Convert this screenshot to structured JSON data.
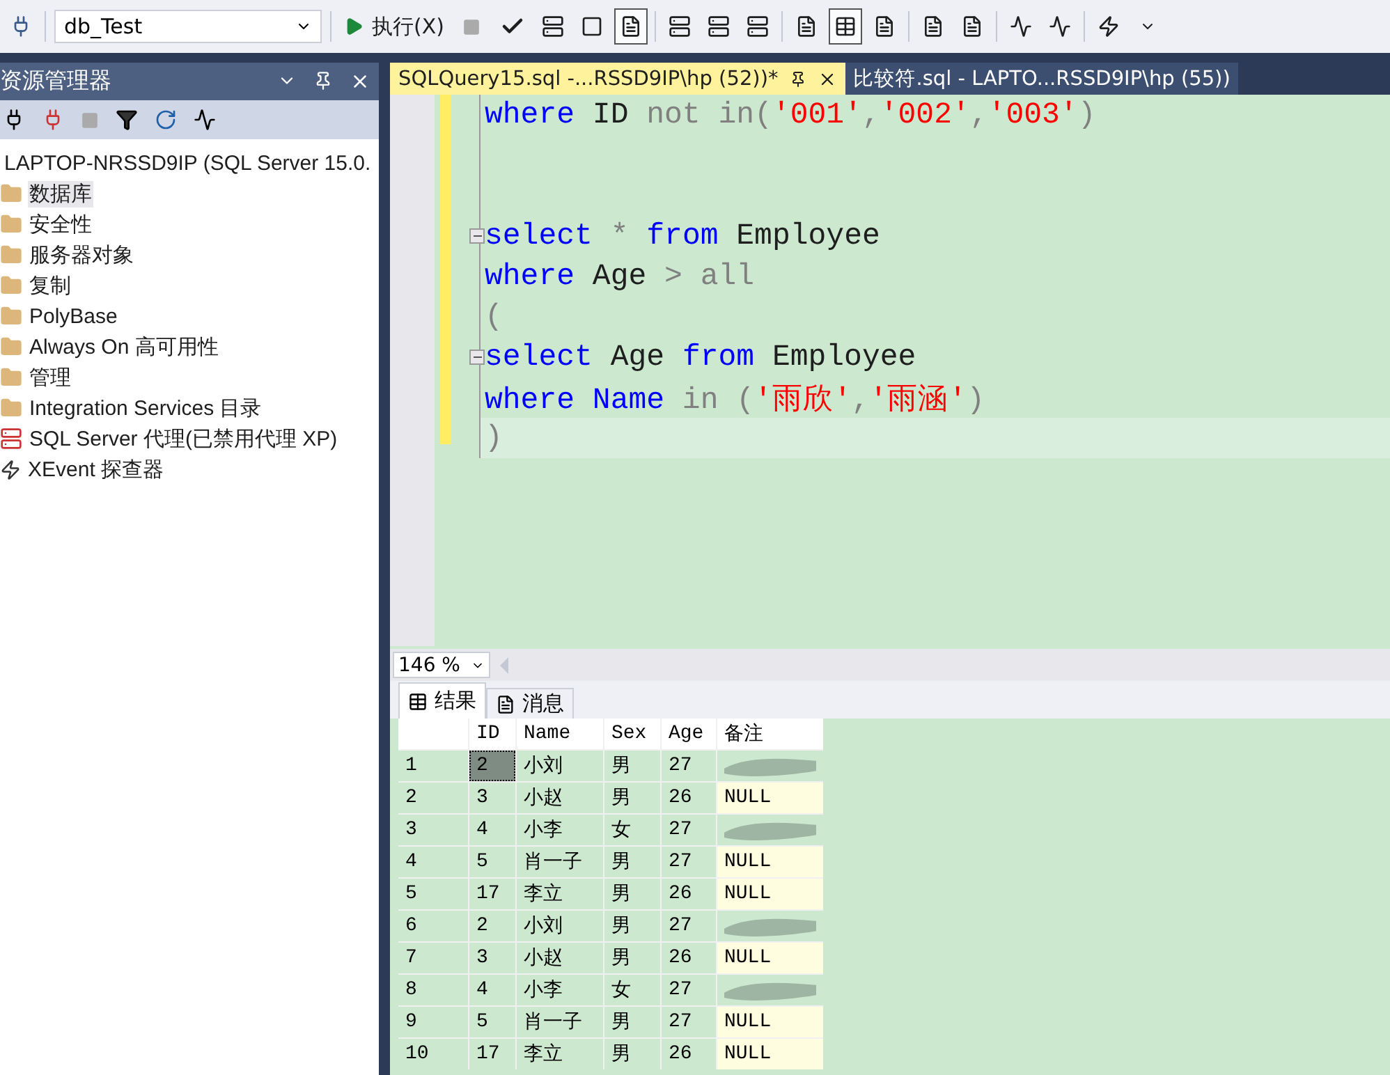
{
  "toolbar": {
    "database": "db_Test",
    "execute": "执行(X)"
  },
  "object_explorer": {
    "title": "资源管理器",
    "tree": [
      {
        "label": "LAPTOP-NRSSD9IP (SQL Server 15.0.",
        "selected": false,
        "children": [
          {
            "label": "数据库",
            "kind": "folder",
            "selected": true
          },
          {
            "label": "安全性",
            "kind": "folder",
            "selected": false
          },
          {
            "label": "服务器对象",
            "kind": "folder",
            "selected": false
          },
          {
            "label": "复制",
            "kind": "folder",
            "selected": false
          },
          {
            "label": "PolyBase",
            "kind": "folder",
            "selected": false
          },
          {
            "label": "Always On 高可用性",
            "kind": "folder",
            "selected": false
          },
          {
            "label": "管理",
            "kind": "folder",
            "selected": false
          },
          {
            "label": "Integration Services 目录",
            "kind": "folder",
            "selected": false
          },
          {
            "label": "SQL Server 代理(已禁用代理 XP)",
            "kind": "agent",
            "selected": false
          },
          {
            "label": "XEvent 探查器",
            "kind": "xevent",
            "selected": false
          }
        ]
      }
    ]
  },
  "tabs": [
    {
      "label": "SQLQuery15.sql -...RSSD9IP\\hp (52))*",
      "selected": true
    },
    {
      "label": "比较符.sql - LAPTO...RSSD9IP\\hp (55))",
      "selected": false
    }
  ],
  "editor": {
    "lines": [
      {
        "fold": false,
        "current": false,
        "tokens": [
          {
            "kind": "keyword",
            "text": "where"
          },
          {
            "kind": "ident",
            "text": " ID "
          },
          {
            "kind": "operator",
            "text": "not in("
          },
          {
            "kind": "string",
            "text": "'001'"
          },
          {
            "kind": "operator",
            "text": ","
          },
          {
            "kind": "string",
            "text": "'002'"
          },
          {
            "kind": "operator",
            "text": ","
          },
          {
            "kind": "string",
            "text": "'003'"
          },
          {
            "kind": "operator",
            "text": ")"
          }
        ]
      },
      {
        "fold": false,
        "current": false
      },
      {
        "fold": false,
        "current": false
      },
      {
        "fold": true,
        "current": false,
        "tokens": [
          {
            "kind": "keyword",
            "text": "select"
          },
          {
            "kind": "operator",
            "text": " * "
          },
          {
            "kind": "keyword",
            "text": "from"
          },
          {
            "kind": "ident",
            "text": " Employee"
          }
        ]
      },
      {
        "fold": false,
        "current": false,
        "tokens": [
          {
            "kind": "keyword",
            "text": "where"
          },
          {
            "kind": "ident",
            "text": " Age "
          },
          {
            "kind": "operator",
            "text": "> all"
          }
        ]
      },
      {
        "fold": false,
        "current": false,
        "tokens": [
          {
            "kind": "operator",
            "text": "("
          }
        ]
      },
      {
        "fold": true,
        "current": false,
        "tokens": [
          {
            "kind": "keyword",
            "text": "select"
          },
          {
            "kind": "ident",
            "text": " Age "
          },
          {
            "kind": "keyword",
            "text": "from"
          },
          {
            "kind": "ident",
            "text": " Employee"
          }
        ]
      },
      {
        "fold": false,
        "current": false,
        "tokens": [
          {
            "kind": "keyword",
            "text": "where Name"
          },
          {
            "kind": "operator",
            "text": " in ("
          },
          {
            "kind": "string",
            "text": "'雨欣'"
          },
          {
            "kind": "operator",
            "text": ","
          },
          {
            "kind": "string",
            "text": "'雨涵'"
          },
          {
            "kind": "operator",
            "text": ")"
          }
        ]
      },
      {
        "fold": false,
        "current": true,
        "tokens": [
          {
            "kind": "operator",
            "text": ")"
          }
        ]
      }
    ],
    "zoom": "146 %"
  },
  "results": {
    "tabs": [
      {
        "label": "结果",
        "kind": "grid",
        "selected": true
      },
      {
        "label": "消息",
        "kind": "messages",
        "selected": false
      }
    ],
    "columns": [
      "ID",
      "Name",
      "Sex",
      "Age",
      "备注"
    ],
    "rows": [
      {
        "number": "1",
        "id": "2",
        "name": "小刘",
        "sex": "男",
        "age": "27",
        "remark_obscured": true,
        "selected": true
      },
      {
        "number": "2",
        "id": "3",
        "name": "小赵",
        "sex": "男",
        "age": "26",
        "remark": "NULL",
        "selected": false
      },
      {
        "number": "3",
        "id": "4",
        "name": "小李",
        "sex": "女",
        "age": "27",
        "remark_obscured": true,
        "selected": false
      },
      {
        "number": "4",
        "id": "5",
        "name": "肖一子",
        "sex": "男",
        "age": "27",
        "remark": "NULL",
        "selected": false
      },
      {
        "number": "5",
        "id": "17",
        "name": "李立",
        "sex": "男",
        "age": "26",
        "remark": "NULL",
        "selected": false
      },
      {
        "number": "6",
        "id": "2",
        "name": "小刘",
        "sex": "男",
        "age": "27",
        "remark_obscured": true,
        "selected": false
      },
      {
        "number": "7",
        "id": "3",
        "name": "小赵",
        "sex": "男",
        "age": "26",
        "remark": "NULL",
        "selected": false
      },
      {
        "number": "8",
        "id": "4",
        "name": "小李",
        "sex": "女",
        "age": "27",
        "remark_obscured": true,
        "selected": false
      },
      {
        "number": "9",
        "id": "5",
        "name": "肖一子",
        "sex": "男",
        "age": "27",
        "remark": "NULL",
        "selected": false
      },
      {
        "number": "10",
        "id": "17",
        "name": "李立",
        "sex": "男",
        "age": "26",
        "remark": "NULL",
        "selected": false
      }
    ]
  }
}
